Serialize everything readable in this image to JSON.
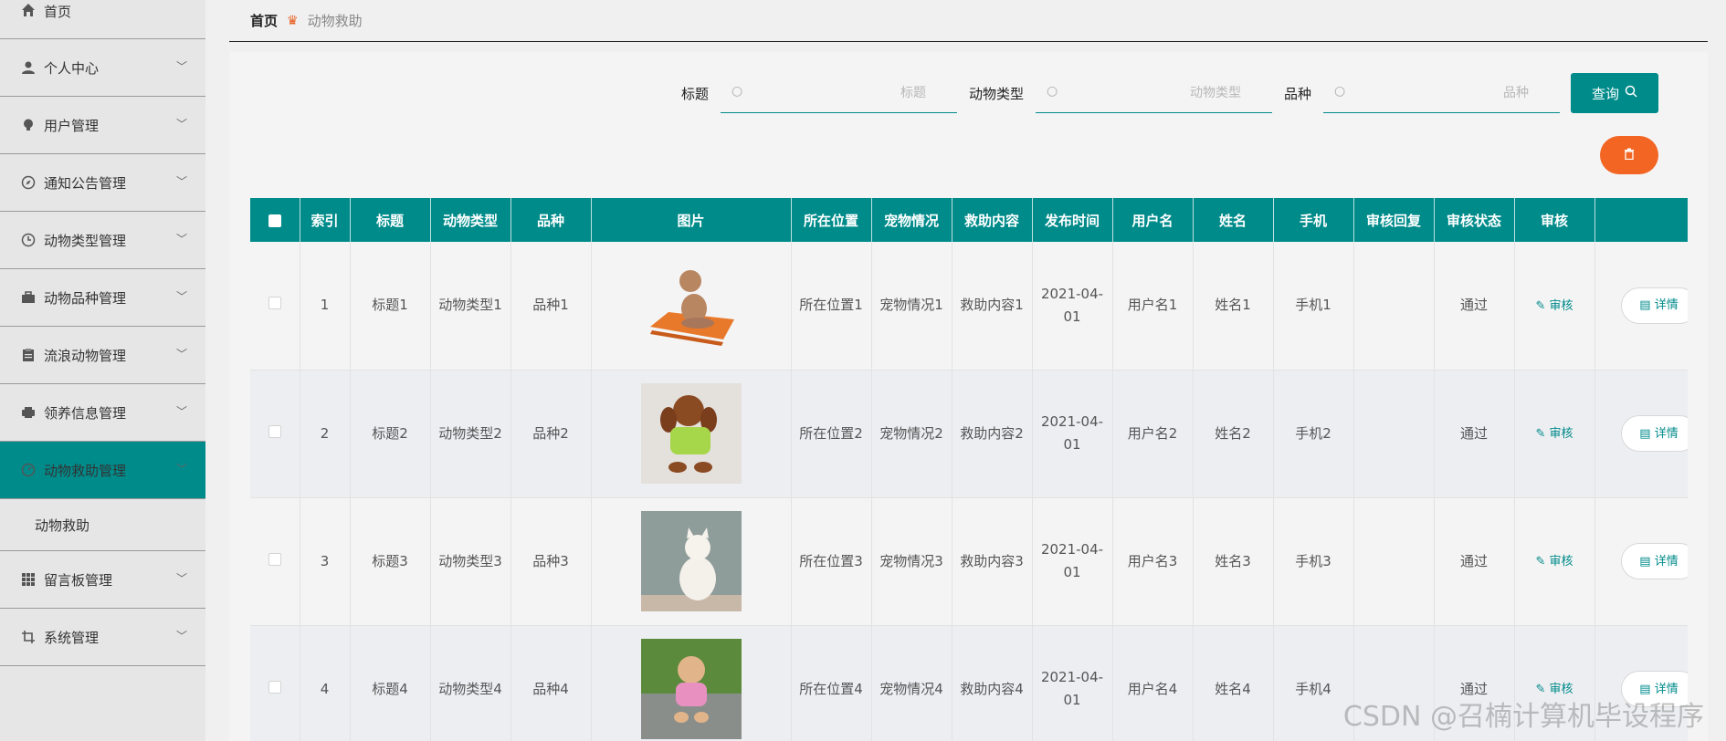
{
  "sidebar": {
    "items": [
      {
        "label": "首页",
        "icon": "home-icon"
      },
      {
        "label": "个人中心",
        "icon": "user-icon"
      },
      {
        "label": "用户管理",
        "icon": "bulb-icon"
      },
      {
        "label": "通知公告管理",
        "icon": "compass-icon"
      },
      {
        "label": "动物类型管理",
        "icon": "clock-icon"
      },
      {
        "label": "动物品种管理",
        "icon": "briefcase-icon"
      },
      {
        "label": "流浪动物管理",
        "icon": "clipboard-icon"
      },
      {
        "label": "领养信息管理",
        "icon": "printer-icon"
      },
      {
        "label": "动物救助管理",
        "icon": "dashboard-icon"
      },
      {
        "label": "留言板管理",
        "icon": "grid-icon"
      },
      {
        "label": "系统管理",
        "icon": "crop-icon"
      }
    ],
    "submenu_label": "动物救助",
    "active_color": "#008b8b"
  },
  "breadcrumb": {
    "home": "首页",
    "current": "动物救助"
  },
  "search": {
    "title_label": "标题",
    "title_placeholder": "标题",
    "type_label": "动物类型",
    "type_placeholder": "动物类型",
    "breed_label": "品种",
    "breed_placeholder": "品种",
    "query_label": "查询"
  },
  "table": {
    "headers": [
      "索引",
      "标题",
      "动物类型",
      "品种",
      "图片",
      "所在位置",
      "宠物情况",
      "救助内容",
      "发布时间",
      "用户名",
      "姓名",
      "手机",
      "审核回复",
      "审核状态",
      "审核",
      ""
    ],
    "rows": [
      {
        "index": "1",
        "title": "标题1",
        "type": "动物类型1",
        "breed": "品种1",
        "location": "所在位置1",
        "pet": "宠物情况1",
        "rescue": "救助内容1",
        "time": "2021-04-01",
        "username": "用户名1",
        "name": "姓名1",
        "phone": "手机1",
        "reply": "",
        "status": "通过",
        "audit": "审核",
        "detail": "详情"
      },
      {
        "index": "2",
        "title": "标题2",
        "type": "动物类型2",
        "breed": "品种2",
        "location": "所在位置2",
        "pet": "宠物情况2",
        "rescue": "救助内容2",
        "time": "2021-04-01",
        "username": "用户名2",
        "name": "姓名2",
        "phone": "手机2",
        "reply": "",
        "status": "通过",
        "audit": "审核",
        "detail": "详情"
      },
      {
        "index": "3",
        "title": "标题3",
        "type": "动物类型3",
        "breed": "品种3",
        "location": "所在位置3",
        "pet": "宠物情况3",
        "rescue": "救助内容3",
        "time": "2021-04-01",
        "username": "用户名3",
        "name": "姓名3",
        "phone": "手机3",
        "reply": "",
        "status": "通过",
        "audit": "审核",
        "detail": "详情"
      },
      {
        "index": "4",
        "title": "标题4",
        "type": "动物类型4",
        "breed": "品种4",
        "location": "所在位置4",
        "pet": "宠物情况4",
        "rescue": "救助内容4",
        "time": "2021-04-01",
        "username": "用户名4",
        "name": "姓名4",
        "phone": "手机4",
        "reply": "",
        "status": "通过",
        "audit": "审核",
        "detail": "详情"
      }
    ]
  },
  "watermark": "CSDN @召楠计算机毕设程序",
  "colors": {
    "accent": "#008b8b",
    "delete": "#f26522"
  }
}
